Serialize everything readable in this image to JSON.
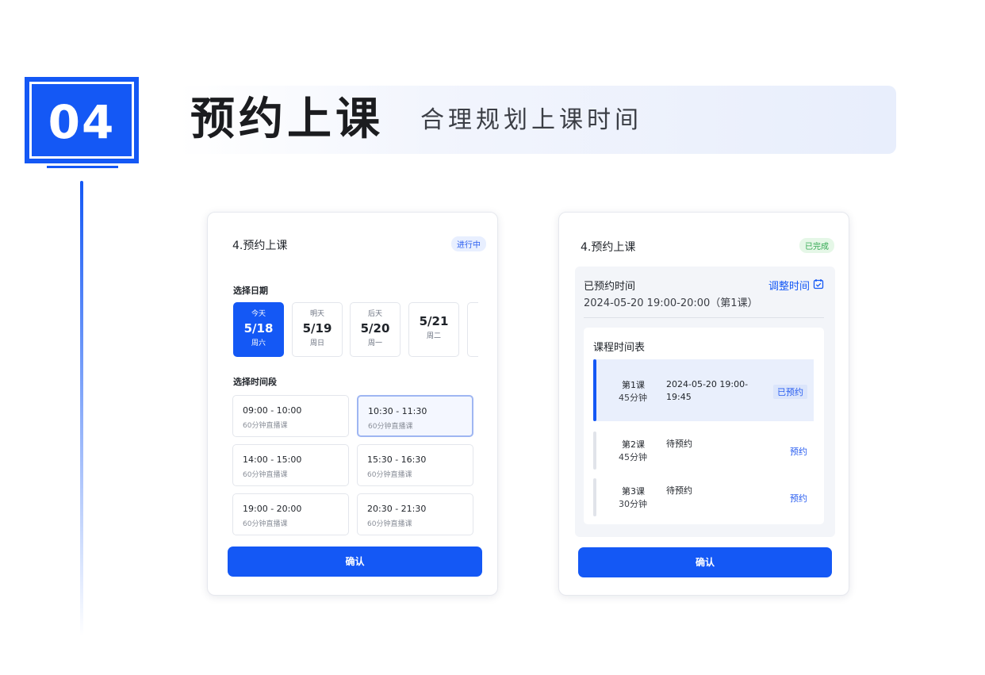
{
  "header": {
    "step_number": "04",
    "title": "预约上课",
    "subtitle": "合理规划上课时间"
  },
  "left_card": {
    "title": "4.预约上课",
    "status": "进行中",
    "date_section_label": "选择日期",
    "dates": [
      {
        "top": "今天",
        "date": "5/18",
        "week": "周六"
      },
      {
        "top": "明天",
        "date": "5/19",
        "week": "周日"
      },
      {
        "top": "后天",
        "date": "5/20",
        "week": "周一"
      },
      {
        "top": "",
        "date": "5/21",
        "week": "周二"
      }
    ],
    "time_section_label": "选择时间段",
    "slots": [
      {
        "time": "09:00 - 10:00",
        "desc": "60分钟直播课"
      },
      {
        "time": "10:30 - 11:30",
        "desc": "60分钟直播课"
      },
      {
        "time": "14:00 - 15:00",
        "desc": "60分钟直播课"
      },
      {
        "time": "15:30 - 16:30",
        "desc": "60分钟直播课"
      },
      {
        "time": "19:00 - 20:00",
        "desc": "60分钟直播课"
      },
      {
        "time": "20:30 - 21:30",
        "desc": "60分钟直播课"
      }
    ],
    "confirm_label": "确认"
  },
  "right_card": {
    "title": "4.预约上课",
    "status": "已完成",
    "booked_label": "已预约时间",
    "booked_value": "2024-05-20 19:00-20:00（第1课）",
    "adjust_label": "调整时间",
    "schedule_title": "课程时间表",
    "lessons": [
      {
        "name": "第1课",
        "duration": "45分钟",
        "info": "2024-05-20 19:00-19:45",
        "action": "已预约"
      },
      {
        "name": "第2课",
        "duration": "45分钟",
        "info": "待预约",
        "action": "预约"
      },
      {
        "name": "第3课",
        "duration": "30分钟",
        "info": "待预约",
        "action": "预约"
      }
    ],
    "confirm_label": "确认"
  },
  "colors": {
    "accent": "#1458f5",
    "status_in_progress": "#2a5ef0",
    "status_done": "#33a852"
  },
  "icons": {
    "adjust_time": "calendar-check-icon"
  }
}
